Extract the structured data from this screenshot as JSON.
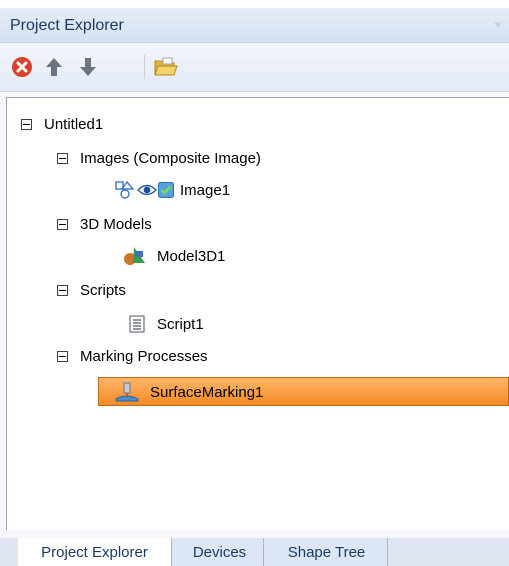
{
  "panel": {
    "title": "Project Explorer"
  },
  "toolbar": {
    "buttons": [
      {
        "icon": "delete-icon"
      },
      {
        "icon": "arrow-up-icon"
      },
      {
        "icon": "arrow-down-icon"
      },
      {
        "icon": "open-folder-icon"
      }
    ]
  },
  "tree": {
    "root": "Untitled1",
    "images_group": "Images (Composite Image)",
    "image1": "Image1",
    "models_group": "3D Models",
    "model1": "Model3D1",
    "scripts_group": "Scripts",
    "script1": "Script1",
    "marking_group": "Marking Processes",
    "marking1": "SurfaceMarking1"
  },
  "tabs": [
    "Project Explorer",
    "Devices",
    "Shape Tree"
  ],
  "colors": {
    "selection": "#f58b25",
    "header": "#d5e1f2"
  }
}
